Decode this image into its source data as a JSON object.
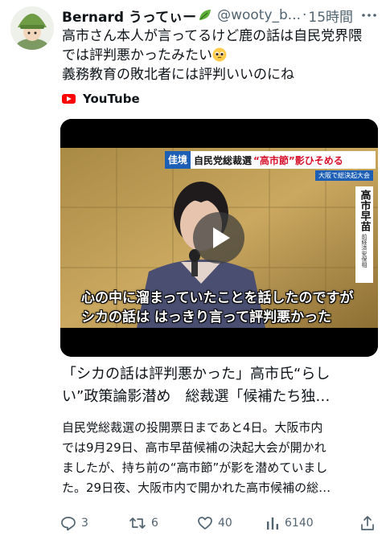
{
  "author": {
    "name": "Bernard うってぃー",
    "handle": "@wooty_b...",
    "separator": "·",
    "time": "15時間"
  },
  "tweet": {
    "lines": [
      "高市さん本人が言ってるけど鹿の話は自民党界隈",
      "では評判悪かったみたい",
      "義務教育の敗北者には評判いいのにね"
    ]
  },
  "link_source": "YouTube",
  "video": {
    "banner_tag": "佳境",
    "banner_text": "自民党総裁選",
    "banner_highlight": "“高市節”影ひそめる",
    "banner_sub": "大阪で総決起大会",
    "side_name": "高市早苗",
    "side_title": "前経済安保相",
    "subtitle_1": "心の中に溜まっていたことを話したのですが",
    "subtitle_2": "シカの話は はっきり言って評判悪かった"
  },
  "card": {
    "title_lines": [
      "「シカの話は評判悪かった」高市氏“らし",
      "い”政策論影潜め　総裁選「候補たち独…"
    ],
    "desc_lines": [
      "自民党総裁選の投開票日まであと4日。大阪市内",
      "では9月29日、高市早苗候補の決起大会が開かれ",
      "ましたが、持ち前の“高市節”が影を潜めていまし",
      "た。29日夜、大阪市内で開かれた高市候補の総…"
    ]
  },
  "actions": {
    "replies": "3",
    "reposts": "6",
    "likes": "40",
    "views": "6140"
  },
  "colors": {
    "text": "#0f1419",
    "muted": "#536471",
    "youtube_red": "#ff0000",
    "banner_red": "#d7102a",
    "banner_blue": "#1d5fb4"
  }
}
